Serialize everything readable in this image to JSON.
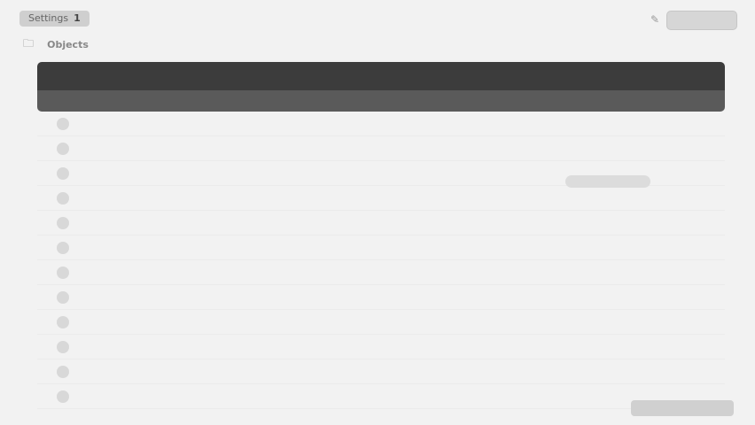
{
  "header": {
    "crumb_label": "Settings",
    "crumb_count": "1",
    "top_icon": "pencil-icon",
    "top_button_label": "",
    "sub_icon": "folder-icon",
    "sub_label": "Objects"
  },
  "table": {
    "title": "",
    "columns": [
      "",
      "",
      "",
      ""
    ],
    "rows": [
      {
        "num": "",
        "name": "",
        "a": "",
        "b": ""
      },
      {
        "num": "",
        "name": "",
        "a": "",
        "b": ""
      },
      {
        "num": "",
        "name": "",
        "a": "",
        "b": ""
      },
      {
        "num": "",
        "name": "",
        "a": "",
        "b": ""
      },
      {
        "num": "",
        "name": "",
        "a": "",
        "b": ""
      },
      {
        "num": "",
        "name": "",
        "a": "",
        "b": ""
      },
      {
        "num": "",
        "name": "",
        "a": "",
        "b": ""
      },
      {
        "num": "",
        "name": "",
        "a": "",
        "b": ""
      },
      {
        "num": "",
        "name": "",
        "a": "",
        "b": ""
      },
      {
        "num": "",
        "name": "",
        "a": "",
        "b": ""
      },
      {
        "num": "",
        "name": "",
        "a": "",
        "b": ""
      },
      {
        "num": "",
        "name": "",
        "a": "",
        "b": ""
      }
    ]
  },
  "overlay": {
    "badge_label": "",
    "bottom_button_label": ""
  }
}
